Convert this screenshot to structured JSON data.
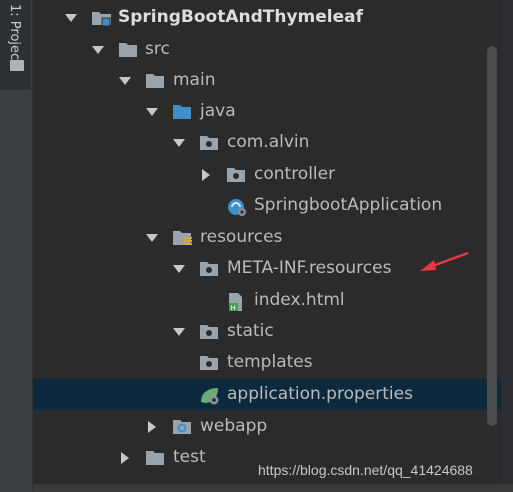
{
  "sidebar": {
    "tab_label": "1: Project"
  },
  "tree": {
    "items": [
      {
        "label": "SpringBootAndThymeleaf",
        "icon": "module-folder-icon",
        "arrow": "expanded",
        "bold": true
      },
      {
        "label": "src",
        "icon": "folder-icon",
        "arrow": "expanded"
      },
      {
        "label": "main",
        "icon": "folder-icon",
        "arrow": "expanded"
      },
      {
        "label": "java",
        "icon": "source-folder-icon",
        "arrow": "expanded"
      },
      {
        "label": "com.alvin",
        "icon": "package-icon",
        "arrow": "expanded"
      },
      {
        "label": "controller",
        "icon": "package-icon",
        "arrow": "collapsed"
      },
      {
        "label": "SpringbootApplication",
        "icon": "spring-boot-class-icon",
        "arrow": "none"
      },
      {
        "label": "resources",
        "icon": "resources-folder-icon",
        "arrow": "expanded"
      },
      {
        "label": "META-INF.resources",
        "icon": "package-icon",
        "arrow": "expanded"
      },
      {
        "label": "index.html",
        "icon": "html-file-icon",
        "arrow": "none"
      },
      {
        "label": "static",
        "icon": "package-icon",
        "arrow": "expanded"
      },
      {
        "label": "templates",
        "icon": "package-icon",
        "arrow": "none"
      },
      {
        "label": "application.properties",
        "icon": "spring-properties-icon",
        "arrow": "none",
        "selected": true
      },
      {
        "label": "webapp",
        "icon": "web-folder-icon",
        "arrow": "collapsed"
      },
      {
        "label": "test",
        "icon": "folder-icon",
        "arrow": "collapsed"
      }
    ]
  },
  "annotation": {
    "color": "#e8383d"
  },
  "colors": {
    "selection": "#0d293e",
    "source_folder": "#3d8ec9",
    "spring_green": "#6aab73"
  },
  "watermark": "https://blog.csdn.net/qq_41424688"
}
